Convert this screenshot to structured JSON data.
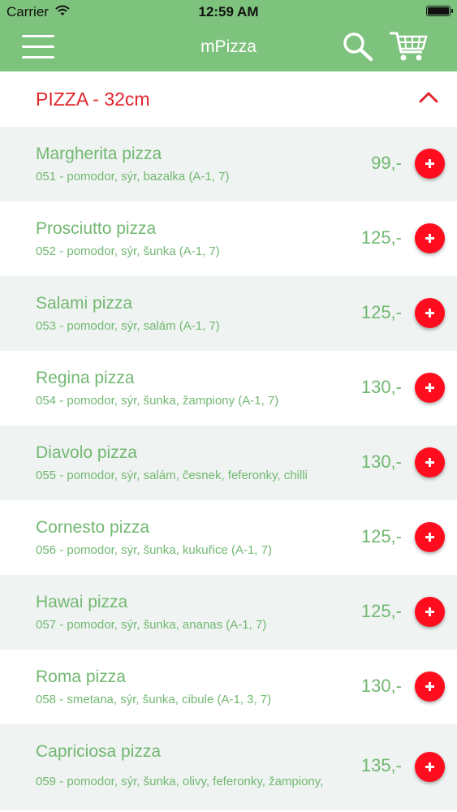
{
  "status_bar": {
    "carrier": "Carrier",
    "time": "12:59 AM"
  },
  "header": {
    "title": "mPizza"
  },
  "category": {
    "title": "PIZZA - 32cm"
  },
  "colors": {
    "brand_green": "#7dc27d",
    "accent_red": "#e0242a",
    "add_button": "#ff0c1e"
  },
  "icons": [
    "menu-icon",
    "search-icon",
    "cart-icon",
    "chevron-up-icon",
    "plus-icon"
  ],
  "items": [
    {
      "name": "Margherita pizza",
      "description": "051 - pomodor, sýr, bazalka (A-1, 7)",
      "price": "99,-"
    },
    {
      "name": "Prosciutto pizza",
      "description": "052 - pomodor, sýr, šunka (A-1, 7)",
      "price": "125,-"
    },
    {
      "name": "Salami pizza",
      "description": "053 - pomodor, sýr, salám (A-1, 7)",
      "price": "125,-"
    },
    {
      "name": "Regina pizza",
      "description": "054 - pomodor, sýr, šunka, žampiony (A-1, 7)",
      "price": "130,-"
    },
    {
      "name": "Diavolo pizza",
      "description": "055 - pomodor, sýr, salám, česnek, feferonky, chilli",
      "price": "130,-"
    },
    {
      "name": "Cornesto pizza",
      "description": "056 - pomodor, sýr, šunka, kukuřice (A-1, 7)",
      "price": "125,-"
    },
    {
      "name": "Hawai pizza",
      "description": "057 - pomodor, sýr, šunka, ananas (A-1, 7)",
      "price": "125,-"
    },
    {
      "name": "Roma pizza",
      "description": "058 - smetana, sýr, šunka, cibule (A-1, 3, 7)",
      "price": "130,-"
    },
    {
      "name": "Capriciosa pizza",
      "description": "059 - pomodor, sýr, šunka, olivy, feferonky, žampiony,",
      "price": "135,-"
    }
  ]
}
